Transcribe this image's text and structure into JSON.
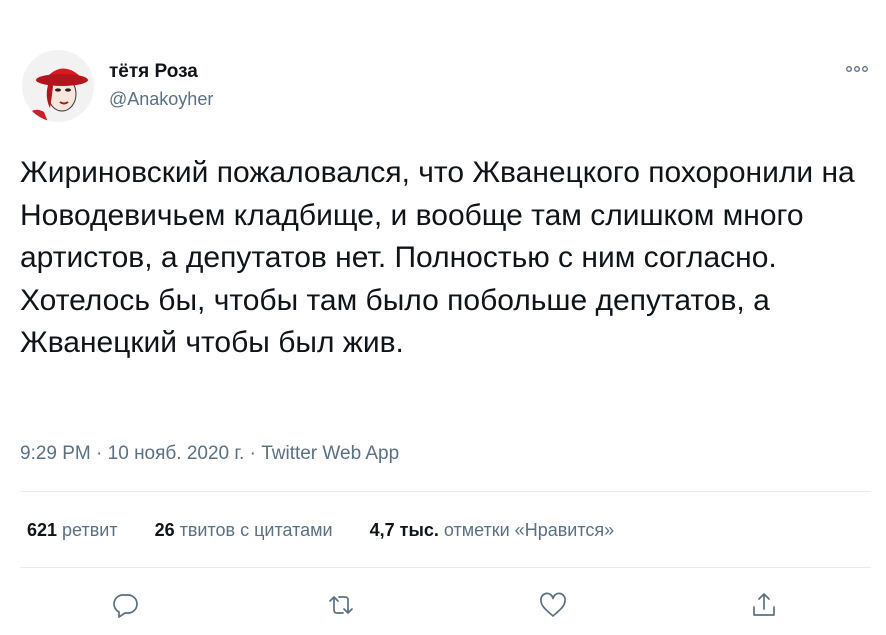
{
  "author": {
    "display_name": "тётя Роза",
    "handle": "@Anakoyher",
    "avatar_icon": "avatar-red-hat-portrait"
  },
  "tweet": {
    "text": "Жириновский пожаловался, что Жванецкого похоронили на Новодевичьем кладбище, и вообще там слишком много артистов, а депутатов нет. Полностью с ним согласно. Хотелось бы, чтобы там было побольше депутатов, а Жванецкий чтобы был жив.",
    "time": "9:29 PM",
    "date": "10 нояб. 2020 г.",
    "source": "Twitter Web App",
    "separator": "·"
  },
  "stats": {
    "retweets_count": "621",
    "retweets_label": "ретвит",
    "quotes_count": "26",
    "quotes_label": "твитов с цитатами",
    "likes_count": "4,7 тыс.",
    "likes_label": "отметки «Нравится»"
  },
  "actions": [
    {
      "icon": "reply-icon"
    },
    {
      "icon": "retweet-icon"
    },
    {
      "icon": "like-icon"
    },
    {
      "icon": "share-icon"
    }
  ],
  "colors": {
    "text": "#0f1419",
    "secondary": "#5b7083",
    "divider": "#e6ecf0",
    "avatar_hat": "#d8191f"
  }
}
